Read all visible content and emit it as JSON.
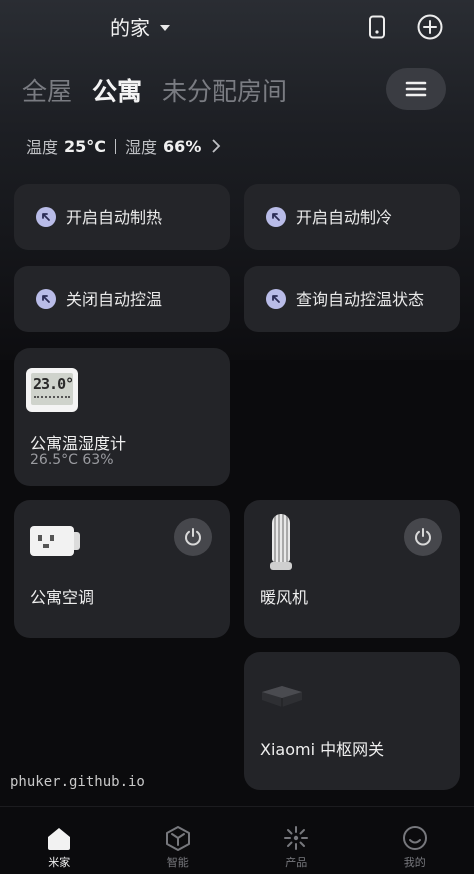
{
  "header": {
    "home_name": "的家"
  },
  "tabs": [
    {
      "label": "全屋"
    },
    {
      "label": "公寓"
    },
    {
      "label": "未分配房间"
    }
  ],
  "climate": {
    "temp_label": "温度",
    "temp_value": "25°C",
    "humidity_label": "湿度",
    "humidity_value": "66%"
  },
  "scenes": [
    {
      "label": "开启自动制热"
    },
    {
      "label": "开启自动制冷"
    },
    {
      "label": "关闭自动控温"
    },
    {
      "label": "查询自动控温状态"
    }
  ],
  "devices": {
    "sensor": {
      "name": "公寓温湿度计",
      "status": "26.5°C 63%",
      "screen_value": "23.0°"
    },
    "ac": {
      "name": "公寓空调"
    },
    "heater": {
      "name": "暖风机"
    },
    "gateway": {
      "name": "Xiaomi 中枢网关"
    }
  },
  "watermark": "phuker.github.io",
  "nav": [
    {
      "label": "米家",
      "icon": "home-icon"
    },
    {
      "label": "智能",
      "icon": "cube-icon"
    },
    {
      "label": "产品",
      "icon": "sparkle-icon"
    },
    {
      "label": "我的",
      "icon": "smile-icon"
    }
  ],
  "colors": {
    "accent": "#b9bce8",
    "card": "#232428",
    "background": "#0b0b0d"
  }
}
